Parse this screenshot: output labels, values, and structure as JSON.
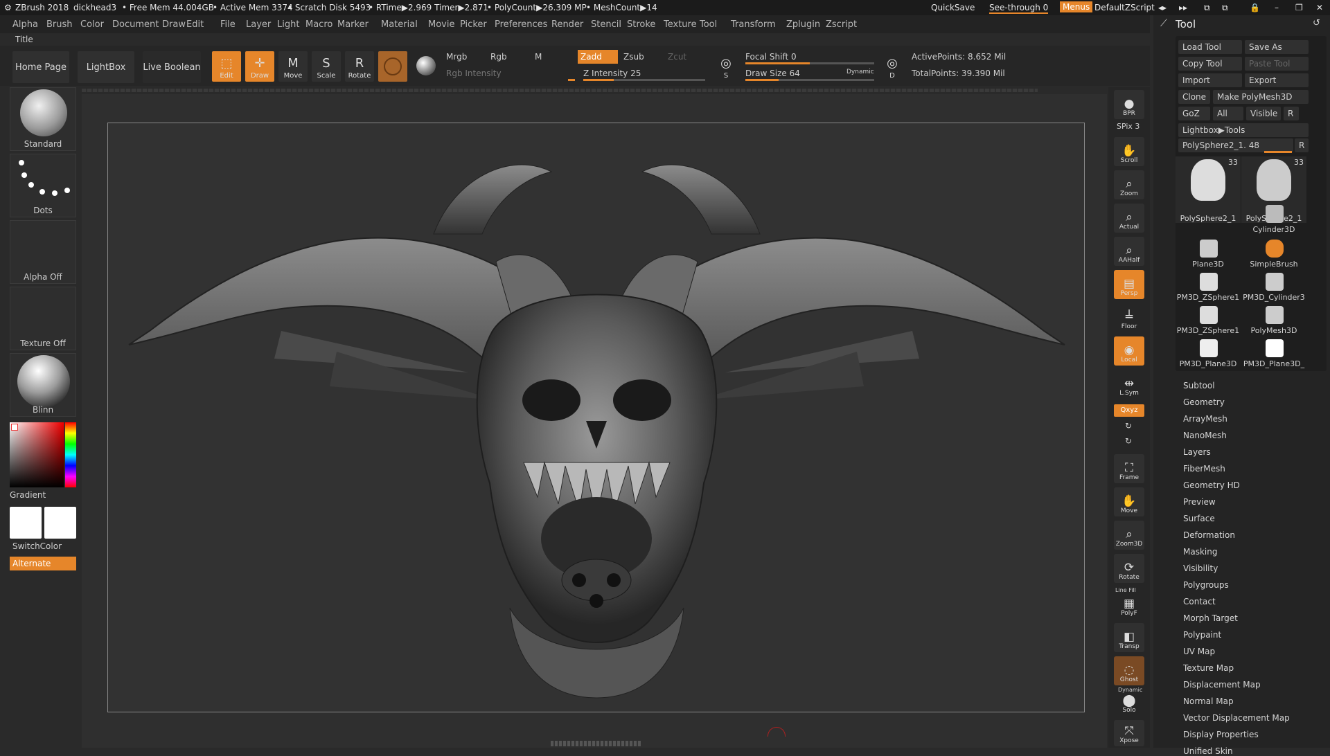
{
  "titlebar": {
    "app": "ZBrush 2018",
    "doc": "dickhead3",
    "free_mem": "• Free Mem 44.004GB",
    "active_mem": "• Active Mem 3374",
    "scratch": "• Scratch Disk 5493",
    "rtime": "• RTime▶2.969 Timer▶2.871",
    "polycount": "• PolyCount▶26.309 MP",
    "meshcount": "• MeshCount▶14",
    "quicksave": "QuickSave",
    "see_through": "See-through  0",
    "menus": "Menus",
    "script": "DefaultZScript"
  },
  "menubar": [
    "Alpha",
    "Brush",
    "Color",
    "Document",
    "Draw",
    "Edit",
    "File",
    "Layer",
    "Light",
    "Macro",
    "Marker",
    "Material",
    "Movie",
    "Picker",
    "Preferences",
    "Render",
    "Stencil",
    "Stroke",
    "Texture",
    "Tool",
    "Transform",
    "Zplugin",
    "Zscript"
  ],
  "title_label": "Title",
  "toolbar": {
    "home": "Home Page",
    "lightbox": "LightBox",
    "live_boolean": "Live Boolean",
    "edit": "Edit",
    "draw": "Draw",
    "move": "Move",
    "scale": "Scale",
    "rotate": "Rotate",
    "mrgb": "Mrgb",
    "rgb": "Rgb",
    "m": "M",
    "zadd": "Zadd",
    "zsub": "Zsub",
    "zcut": "Zcut",
    "rgb_intensity": "Rgb Intensity",
    "z_intensity": "Z Intensity 25",
    "focal_shift": "Focal Shift 0",
    "draw_size": "Draw Size 64",
    "dynamic": "Dynamic",
    "active_points": "ActivePoints: 8.652 Mil",
    "total_points": "TotalPoints: 39.390 Mil",
    "z_intensity_value": 25,
    "focal_shift_value": 0,
    "draw_size_value": 64
  },
  "left": {
    "standard": "Standard",
    "dots": "Dots",
    "alpha_off": "Alpha Off",
    "texture_off": "Texture Off",
    "blinn": "Blinn",
    "gradient": "Gradient",
    "switchcolor": "SwitchColor",
    "alternate": "Alternate"
  },
  "rightstrip": {
    "bpr": "BPR",
    "spix": "SPix 3",
    "scroll": "Scroll",
    "zoom": "Zoom",
    "actual": "Actual",
    "aahalf": "AAHalf",
    "persp": "Persp",
    "floor": "Floor",
    "local": "Local",
    "lsym": "L.Sym",
    "xyz": "Qxyz",
    "frame": "Frame",
    "move": "Move",
    "zoom3d": "Zoom3D",
    "rotate": "Rotate",
    "polyf": "PolyF",
    "linefill": "Line Fill",
    "transp": "Transp",
    "ghost": "Ghost",
    "solo": "Solo",
    "dynamic": "Dynamic",
    "xpose": "Xpose"
  },
  "toolpanel": {
    "title": "Tool",
    "load_tool": "Load Tool",
    "save_as": "Save As",
    "copy_tool": "Copy Tool",
    "paste_tool": "Paste Tool",
    "import": "Import",
    "export": "Export",
    "clone": "Clone",
    "make_polymesh": "Make PolyMesh3D",
    "goz": "GoZ",
    "all": "All",
    "visible": "Visible",
    "r": "R",
    "lightbox_tools": "Lightbox▶Tools",
    "current_tool": "PolySphere2_1. 48",
    "tiles": [
      {
        "label": "PolySphere2_1",
        "count": "33"
      },
      {
        "label": "PolySphere2_1",
        "count": "33"
      },
      {
        "label": "Cylinder3D",
        "count": ""
      },
      {
        "label": "Plane3D",
        "count": ""
      },
      {
        "label": "SimpleBrush",
        "count": ""
      },
      {
        "label": "PM3D_ZSphere1",
        "count": ""
      },
      {
        "label": "PM3D_Cylinder3",
        "count": ""
      },
      {
        "label": "PM3D_ZSphere1",
        "count": ""
      },
      {
        "label": "PolyMesh3D",
        "count": ""
      },
      {
        "label": "PM3D_Plane3D",
        "count": ""
      },
      {
        "label": "PM3D_Plane3D_",
        "count": ""
      }
    ],
    "menu": [
      "Subtool",
      "Geometry",
      "ArrayMesh",
      "NanoMesh",
      "Layers",
      "FiberMesh",
      "Geometry HD",
      "Preview",
      "Surface",
      "Deformation",
      "Masking",
      "Visibility",
      "Polygroups",
      "Contact",
      "Morph Target",
      "Polypaint",
      "UV Map",
      "Texture Map",
      "Displacement Map",
      "Normal Map",
      "Vector Displacement Map",
      "Display Properties",
      "Unified Skin"
    ]
  },
  "colors": {
    "accent": "#e6862a",
    "bg": "#2a2a2a"
  }
}
